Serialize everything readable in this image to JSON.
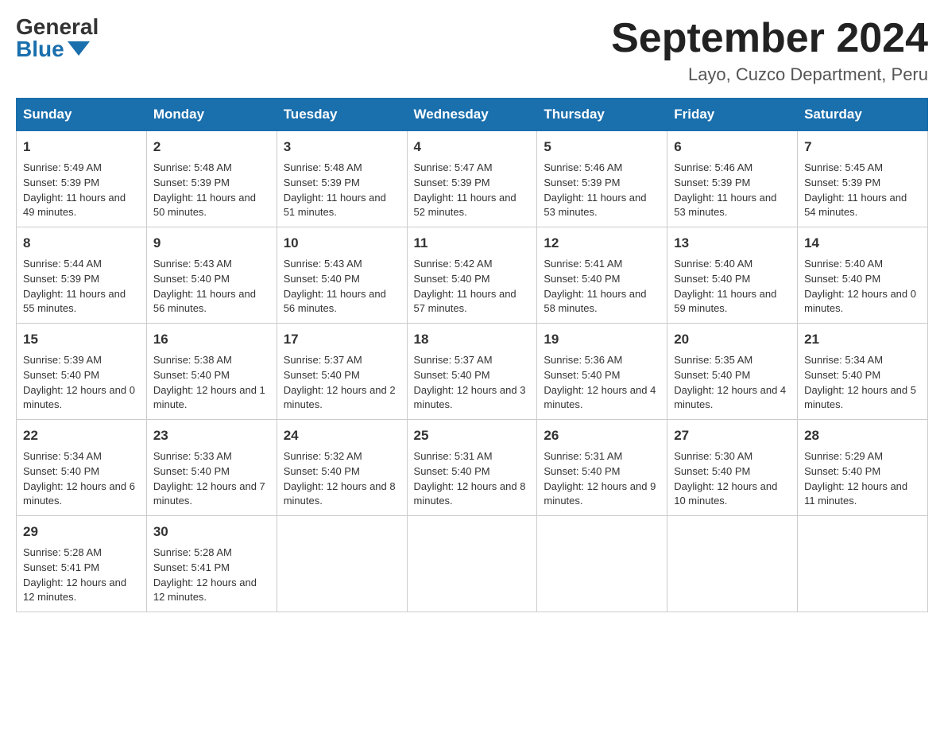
{
  "header": {
    "logo_general": "General",
    "logo_blue": "Blue",
    "title": "September 2024",
    "subtitle": "Layo, Cuzco Department, Peru"
  },
  "days_of_week": [
    "Sunday",
    "Monday",
    "Tuesday",
    "Wednesday",
    "Thursday",
    "Friday",
    "Saturday"
  ],
  "weeks": [
    [
      {
        "day": "1",
        "sunrise": "Sunrise: 5:49 AM",
        "sunset": "Sunset: 5:39 PM",
        "daylight": "Daylight: 11 hours and 49 minutes."
      },
      {
        "day": "2",
        "sunrise": "Sunrise: 5:48 AM",
        "sunset": "Sunset: 5:39 PM",
        "daylight": "Daylight: 11 hours and 50 minutes."
      },
      {
        "day": "3",
        "sunrise": "Sunrise: 5:48 AM",
        "sunset": "Sunset: 5:39 PM",
        "daylight": "Daylight: 11 hours and 51 minutes."
      },
      {
        "day": "4",
        "sunrise": "Sunrise: 5:47 AM",
        "sunset": "Sunset: 5:39 PM",
        "daylight": "Daylight: 11 hours and 52 minutes."
      },
      {
        "day": "5",
        "sunrise": "Sunrise: 5:46 AM",
        "sunset": "Sunset: 5:39 PM",
        "daylight": "Daylight: 11 hours and 53 minutes."
      },
      {
        "day": "6",
        "sunrise": "Sunrise: 5:46 AM",
        "sunset": "Sunset: 5:39 PM",
        "daylight": "Daylight: 11 hours and 53 minutes."
      },
      {
        "day": "7",
        "sunrise": "Sunrise: 5:45 AM",
        "sunset": "Sunset: 5:39 PM",
        "daylight": "Daylight: 11 hours and 54 minutes."
      }
    ],
    [
      {
        "day": "8",
        "sunrise": "Sunrise: 5:44 AM",
        "sunset": "Sunset: 5:39 PM",
        "daylight": "Daylight: 11 hours and 55 minutes."
      },
      {
        "day": "9",
        "sunrise": "Sunrise: 5:43 AM",
        "sunset": "Sunset: 5:40 PM",
        "daylight": "Daylight: 11 hours and 56 minutes."
      },
      {
        "day": "10",
        "sunrise": "Sunrise: 5:43 AM",
        "sunset": "Sunset: 5:40 PM",
        "daylight": "Daylight: 11 hours and 56 minutes."
      },
      {
        "day": "11",
        "sunrise": "Sunrise: 5:42 AM",
        "sunset": "Sunset: 5:40 PM",
        "daylight": "Daylight: 11 hours and 57 minutes."
      },
      {
        "day": "12",
        "sunrise": "Sunrise: 5:41 AM",
        "sunset": "Sunset: 5:40 PM",
        "daylight": "Daylight: 11 hours and 58 minutes."
      },
      {
        "day": "13",
        "sunrise": "Sunrise: 5:40 AM",
        "sunset": "Sunset: 5:40 PM",
        "daylight": "Daylight: 11 hours and 59 minutes."
      },
      {
        "day": "14",
        "sunrise": "Sunrise: 5:40 AM",
        "sunset": "Sunset: 5:40 PM",
        "daylight": "Daylight: 12 hours and 0 minutes."
      }
    ],
    [
      {
        "day": "15",
        "sunrise": "Sunrise: 5:39 AM",
        "sunset": "Sunset: 5:40 PM",
        "daylight": "Daylight: 12 hours and 0 minutes."
      },
      {
        "day": "16",
        "sunrise": "Sunrise: 5:38 AM",
        "sunset": "Sunset: 5:40 PM",
        "daylight": "Daylight: 12 hours and 1 minute."
      },
      {
        "day": "17",
        "sunrise": "Sunrise: 5:37 AM",
        "sunset": "Sunset: 5:40 PM",
        "daylight": "Daylight: 12 hours and 2 minutes."
      },
      {
        "day": "18",
        "sunrise": "Sunrise: 5:37 AM",
        "sunset": "Sunset: 5:40 PM",
        "daylight": "Daylight: 12 hours and 3 minutes."
      },
      {
        "day": "19",
        "sunrise": "Sunrise: 5:36 AM",
        "sunset": "Sunset: 5:40 PM",
        "daylight": "Daylight: 12 hours and 4 minutes."
      },
      {
        "day": "20",
        "sunrise": "Sunrise: 5:35 AM",
        "sunset": "Sunset: 5:40 PM",
        "daylight": "Daylight: 12 hours and 4 minutes."
      },
      {
        "day": "21",
        "sunrise": "Sunrise: 5:34 AM",
        "sunset": "Sunset: 5:40 PM",
        "daylight": "Daylight: 12 hours and 5 minutes."
      }
    ],
    [
      {
        "day": "22",
        "sunrise": "Sunrise: 5:34 AM",
        "sunset": "Sunset: 5:40 PM",
        "daylight": "Daylight: 12 hours and 6 minutes."
      },
      {
        "day": "23",
        "sunrise": "Sunrise: 5:33 AM",
        "sunset": "Sunset: 5:40 PM",
        "daylight": "Daylight: 12 hours and 7 minutes."
      },
      {
        "day": "24",
        "sunrise": "Sunrise: 5:32 AM",
        "sunset": "Sunset: 5:40 PM",
        "daylight": "Daylight: 12 hours and 8 minutes."
      },
      {
        "day": "25",
        "sunrise": "Sunrise: 5:31 AM",
        "sunset": "Sunset: 5:40 PM",
        "daylight": "Daylight: 12 hours and 8 minutes."
      },
      {
        "day": "26",
        "sunrise": "Sunrise: 5:31 AM",
        "sunset": "Sunset: 5:40 PM",
        "daylight": "Daylight: 12 hours and 9 minutes."
      },
      {
        "day": "27",
        "sunrise": "Sunrise: 5:30 AM",
        "sunset": "Sunset: 5:40 PM",
        "daylight": "Daylight: 12 hours and 10 minutes."
      },
      {
        "day": "28",
        "sunrise": "Sunrise: 5:29 AM",
        "sunset": "Sunset: 5:40 PM",
        "daylight": "Daylight: 12 hours and 11 minutes."
      }
    ],
    [
      {
        "day": "29",
        "sunrise": "Sunrise: 5:28 AM",
        "sunset": "Sunset: 5:41 PM",
        "daylight": "Daylight: 12 hours and 12 minutes."
      },
      {
        "day": "30",
        "sunrise": "Sunrise: 5:28 AM",
        "sunset": "Sunset: 5:41 PM",
        "daylight": "Daylight: 12 hours and 12 minutes."
      },
      null,
      null,
      null,
      null,
      null
    ]
  ]
}
